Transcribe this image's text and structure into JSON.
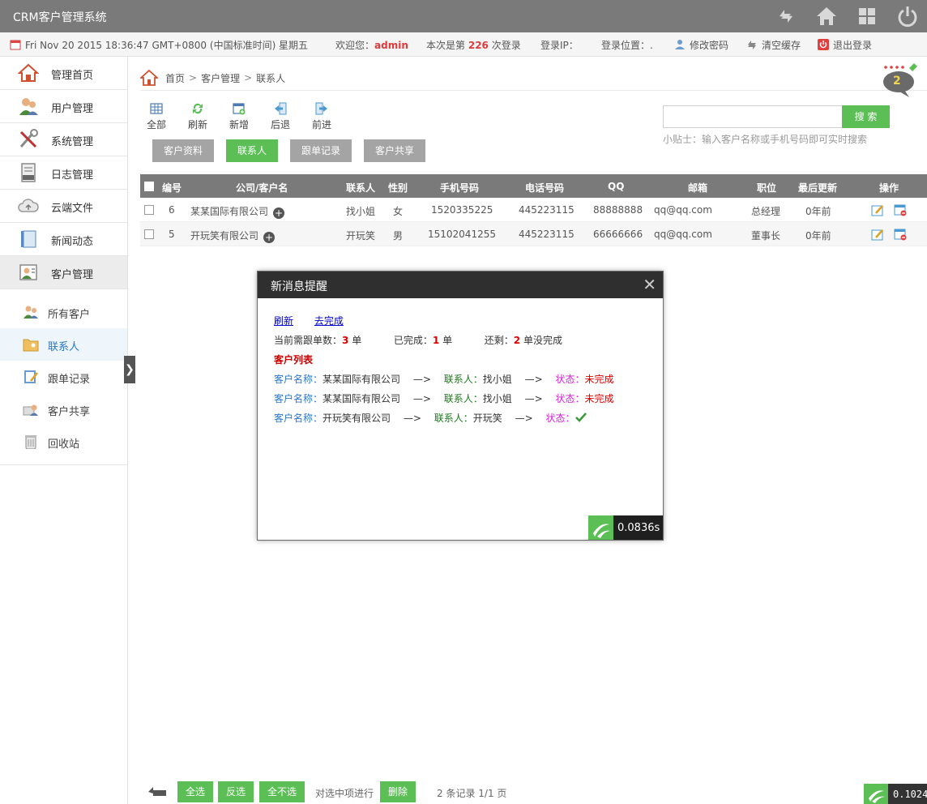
{
  "app": {
    "title": "CRM客户管理系统"
  },
  "infobar": {
    "datetime": "Fri Nov 20 2015 18:36:47 GMT+0800 (中国标准时间) 星期五",
    "welcome_label": "欢迎您：",
    "username": "admin",
    "login_count_prefix": "本次是第",
    "login_count": "226",
    "login_count_suffix": "次登录",
    "login_ip_label": "登录IP：",
    "login_location_label": "登录位置：.",
    "change_password": "修改密码",
    "clear_cache": "清空缓存",
    "logout": "退出登录"
  },
  "sidebar": {
    "items": [
      {
        "label": "管理首页"
      },
      {
        "label": "用户管理"
      },
      {
        "label": "系统管理"
      },
      {
        "label": "日志管理"
      },
      {
        "label": "云端文件"
      },
      {
        "label": "新闻动态"
      },
      {
        "label": "客户管理"
      }
    ],
    "sub_items": [
      {
        "label": "所有客户"
      },
      {
        "label": "联系人"
      },
      {
        "label": "跟单记录"
      },
      {
        "label": "客户共享"
      },
      {
        "label": "回收站"
      }
    ],
    "collapse_glyph": "❯"
  },
  "breadcrumb": {
    "home": "首页",
    "sep": ">",
    "level1": "客户管理",
    "level2": "联系人"
  },
  "message_badge": {
    "count": "2"
  },
  "toolbar": {
    "all": "全部",
    "refresh": "刷新",
    "add": "新增",
    "back": "后退",
    "forward": "前进"
  },
  "tabs": {
    "customer_info": "客户资料",
    "contacts": "联系人",
    "followup": "跟单记录",
    "share": "客户共享"
  },
  "search": {
    "button": "搜 索",
    "value": "",
    "tip": "小贴士：输入客户名称或手机号码即可实时搜索"
  },
  "table": {
    "headers": {
      "id": "编号",
      "company": "公司/客户名",
      "contact": "联系人",
      "gender": "性别",
      "mobile": "手机号码",
      "phone": "电话号码",
      "qq": "QQ",
      "email": "邮箱",
      "position": "职位",
      "updated": "最后更新",
      "actions": "操作"
    },
    "rows": [
      {
        "id": "6",
        "company": "某某国际有限公司",
        "contact": "找小姐",
        "gender": "女",
        "mobile": "1520335225",
        "phone": "445223115",
        "qq": "88888888",
        "email": "qq@qq.com",
        "position": "总经理",
        "updated": "0年前"
      },
      {
        "id": "5",
        "company": "开玩笑有限公司",
        "contact": "开玩笑",
        "gender": "男",
        "mobile": "15102041255",
        "phone": "445223115",
        "qq": "66666666",
        "email": "qq@qq.com",
        "position": "董事长",
        "updated": "0年前"
      }
    ]
  },
  "bottombar": {
    "select_all": "全选",
    "invert": "反选",
    "select_none": "全不选",
    "action_label": "对选中项进行",
    "delete": "删除",
    "records": "2 条记录 1/1 页",
    "timer": "0.1024"
  },
  "dialog": {
    "title": "新消息提醒",
    "close_glyph": "✕",
    "refresh_link": "刷新",
    "complete_link": "去完成",
    "stats": {
      "need_label": "当前需跟单数：",
      "need_count": "3",
      "need_unit": "单",
      "done_label": "已完成：",
      "done_count": "1",
      "done_unit": "单",
      "left_label": "还剩：",
      "left_count": "2",
      "left_unit": "单没完成"
    },
    "list_title": "客户列表",
    "arrow": "—>",
    "name_label": "客户名称：",
    "contact_label": "联系人：",
    "status_label": "状态：",
    "entries": [
      {
        "name": "某某国际有限公司",
        "contact": "找小姐",
        "status": "未完成"
      },
      {
        "name": "某某国际有限公司",
        "contact": "找小姐",
        "status": "未完成"
      },
      {
        "name": "开玩笑有限公司",
        "contact": "开玩笑",
        "status": ""
      }
    ],
    "timer": "0.0836s"
  }
}
